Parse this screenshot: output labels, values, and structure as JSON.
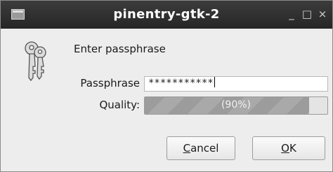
{
  "window": {
    "title": "pinentry-gtk-2",
    "minimize_glyph": "_",
    "maximize_glyph": "□",
    "close_glyph": "×"
  },
  "dialog": {
    "icon": "keys-icon",
    "prompt": "Enter passphrase",
    "passphrase_label": "Passphrase",
    "passphrase_value": "***********",
    "quality_label": "Quality:",
    "quality_text": "(90%)",
    "quality_fraction": 0.9
  },
  "buttons": {
    "cancel_mnemonic": "C",
    "cancel_rest": "ancel",
    "ok_mnemonic": "O",
    "ok_rest": "K"
  }
}
